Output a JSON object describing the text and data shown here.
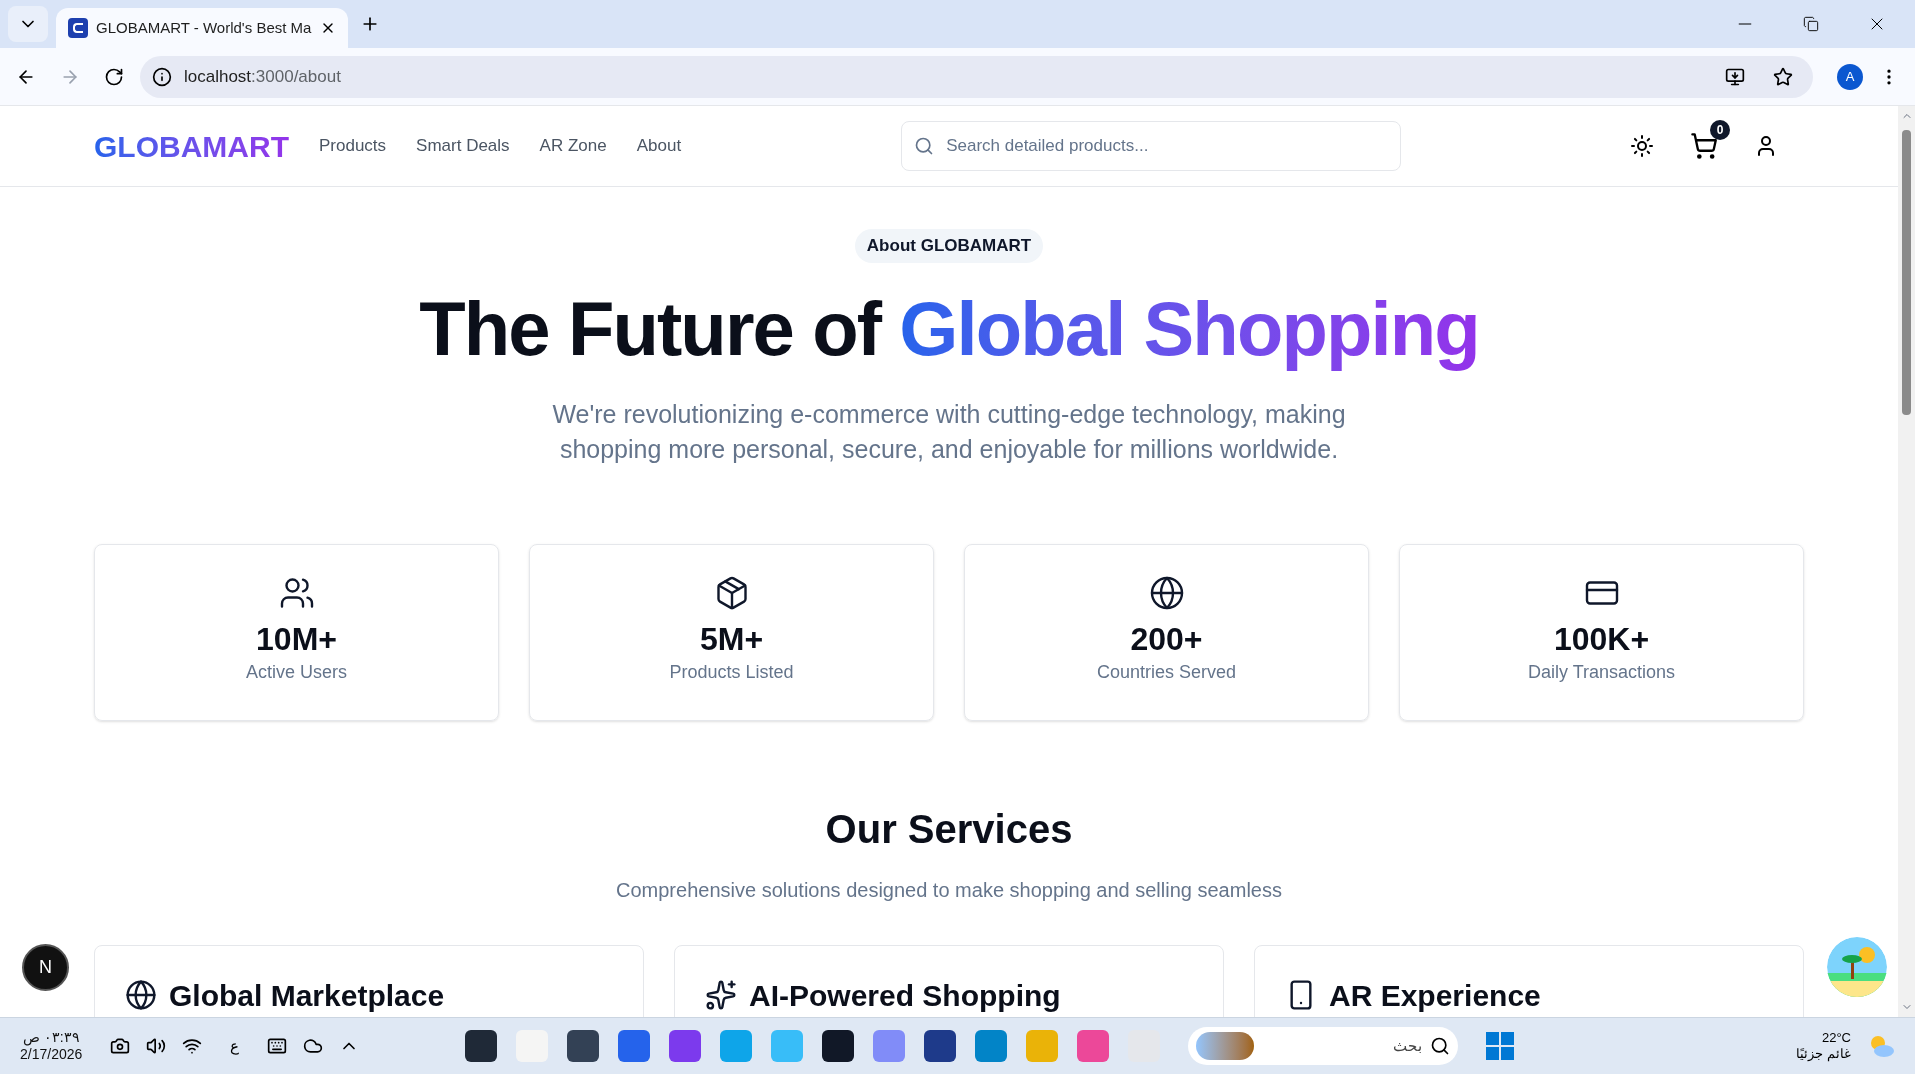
{
  "browser": {
    "tab_title": "GLOBAMART - World's Best Ma",
    "url_host": "localhost",
    "url_path": ":3000/about",
    "profile": "A"
  },
  "header": {
    "logo": "GLOBAMART",
    "nav": [
      "Products",
      "Smart Deals",
      "AR Zone",
      "About"
    ],
    "search": {
      "placeholder": "Search detailed products..."
    },
    "cart_count": "0"
  },
  "hero": {
    "badge": "About GLOBAMART",
    "title_plain": "The Future of ",
    "title_gradient": "Global Shopping",
    "subtitle": "We're revolutionizing e-commerce with cutting-edge technology, making shopping more personal, secure, and enjoyable for millions worldwide."
  },
  "stats": [
    {
      "kind": "users",
      "value": "10M+",
      "label": "Active Users"
    },
    {
      "kind": "box",
      "value": "5M+",
      "label": "Products Listed"
    },
    {
      "kind": "globe",
      "value": "200+",
      "label": "Countries Served"
    },
    {
      "kind": "card",
      "value": "100K+",
      "label": "Daily Transactions"
    }
  ],
  "services": {
    "title": "Our Services",
    "subtitle": "Comprehensive solutions designed to make shopping and selling seamless",
    "items": [
      {
        "kind": "globe",
        "title": "Global Marketplace"
      },
      {
        "kind": "sparkles",
        "title": "AI-Powered Shopping"
      },
      {
        "kind": "phone",
        "title": "AR Experience"
      }
    ]
  },
  "floating_avatar": "N",
  "taskbar": {
    "time": "٠٣:٣٩ ص",
    "date": "2/17/2026",
    "keyboard": "ع",
    "search_placeholder": "بحث",
    "temperature": "22°C",
    "weather": "غائم جزئيًا"
  }
}
